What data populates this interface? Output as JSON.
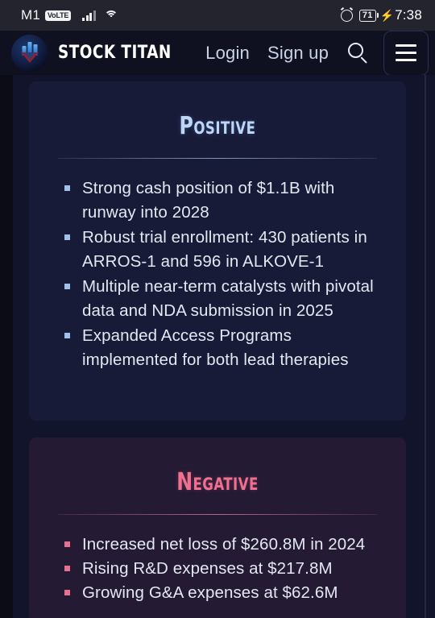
{
  "statusbar": {
    "carrier": "M1",
    "volte_badge": "VoLTE",
    "signal_icon": "signal-bars-icon",
    "wifi_icon": "wifi-icon",
    "alarm_icon": "alarm-clock-icon",
    "battery_level": "71",
    "charging_icon": "charging-bolt-icon",
    "time": "7:38"
  },
  "navbar": {
    "logo_icon": "stock-titan-logo-icon",
    "brand_name": "STOCK TITAN",
    "login_label": "Login",
    "signup_label": "Sign up",
    "search_icon": "search-icon",
    "menu_icon": "hamburger-menu-icon"
  },
  "cards": [
    {
      "id": "positive",
      "title": "Positive",
      "accent": "#bcd6f5",
      "background": "#181b38",
      "bullets": [
        "Strong cash position of $1.1B with runway into 2028",
        "Robust trial enrollment: 430 patients in ARROS-1 and 596 in ALKOVE-1",
        "Multiple near-term catalysts with pivotal data and NDA submission in 2025",
        "Expanded Access Programs implemented for both lead therapies"
      ]
    },
    {
      "id": "negative",
      "title": "Negative",
      "accent": "#f2708f",
      "background": "#241a33",
      "bullets": [
        "Increased net loss of $260.8M in 2024",
        "Rising R&D expenses at $217.8M",
        "Growing G&A expenses at $62.6M"
      ]
    }
  ]
}
